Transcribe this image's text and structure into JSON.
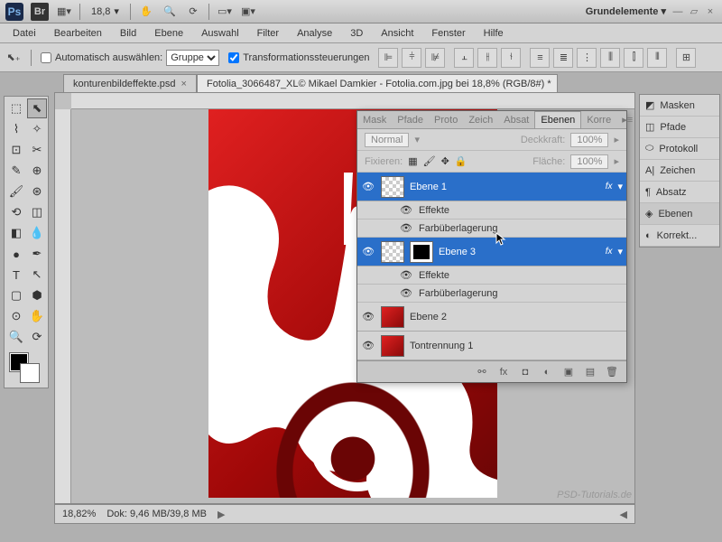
{
  "topbar": {
    "zoom_display": "18,8",
    "workspace": "Grundelemente ▾"
  },
  "menu": {
    "datei": "Datei",
    "bearbeiten": "Bearbeiten",
    "bild": "Bild",
    "ebene": "Ebene",
    "auswahl": "Auswahl",
    "filter": "Filter",
    "analyse": "Analyse",
    "dreiD": "3D",
    "ansicht": "Ansicht",
    "fenster": "Fenster",
    "hilfe": "Hilfe"
  },
  "optbar": {
    "auto_select": "Automatisch auswählen:",
    "group": "Gruppe",
    "transform": "Transformationssteuerungen"
  },
  "tabs": {
    "t1": "konturenbildeffekte.psd",
    "t2": "Fotolia_3066487_XL© Mikael Damkier - Fotolia.com.jpg bei 18,8% (RGB/8#) *"
  },
  "panel_tabs": {
    "mask": "Mask",
    "pfade": "Pfade",
    "proto": "Proto",
    "zeich": "Zeich",
    "absat": "Absat",
    "ebenen": "Ebenen",
    "korre": "Korre"
  },
  "layer_opts": {
    "blend": "Normal",
    "opacity_label": "Deckkraft:",
    "opacity": "100%",
    "lock_label": "Fixieren:",
    "fill_label": "Fläche:",
    "fill": "100%"
  },
  "layers": {
    "l1": "Ebene 1",
    "l1_fx": "fx",
    "l1_effects": "Effekte",
    "l1_color": "Farbüberlagerung",
    "l3": "Ebene 3",
    "l3_fx": "fx",
    "l3_effects": "Effekte",
    "l3_color": "Farbüberlagerung",
    "l2": "Ebene 2",
    "tone": "Tontrennung 1"
  },
  "rpanel": {
    "masken": "Masken",
    "pfade": "Pfade",
    "protokoll": "Protokoll",
    "zeichen": "Zeichen",
    "absatz": "Absatz",
    "ebenen": "Ebenen",
    "korrekt": "Korrekt..."
  },
  "status": {
    "zoom": "18,82%",
    "doc": "Dok: 9,46 MB/39,8 MB"
  },
  "watermark": "PSD-Tutorials.de"
}
